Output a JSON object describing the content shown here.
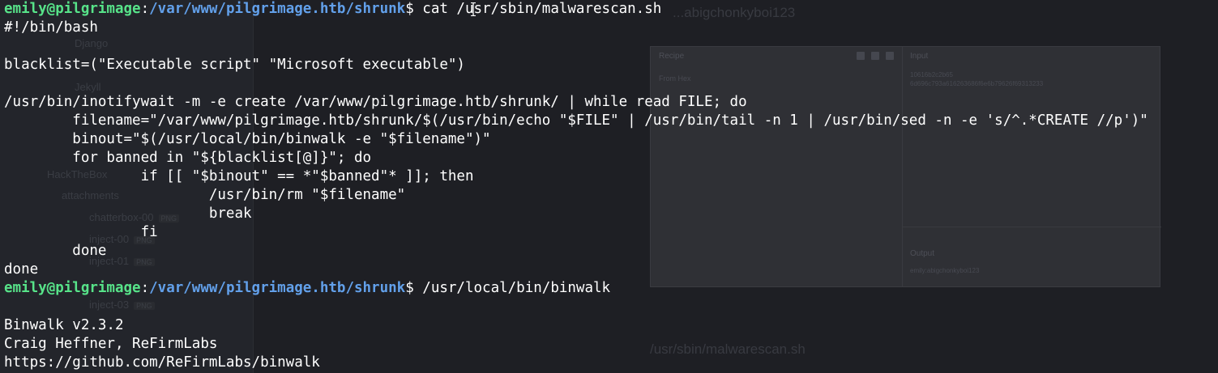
{
  "background": {
    "tree_items": [
      {
        "label": "Django",
        "badge": ""
      },
      {
        "label": "Jekyll",
        "badge": ""
      },
      {
        "label": "HackTheBox",
        "badge": ""
      },
      {
        "label": "attachments",
        "badge": ""
      },
      {
        "label": "chatterbox-00",
        "badge": "PNG"
      },
      {
        "label": "inject-00",
        "badge": "PNG"
      },
      {
        "label": "inject-01",
        "badge": "PNG"
      },
      {
        "label": "inject-03",
        "badge": "PNG"
      }
    ],
    "faint_top_text": "...abigchonkyboi123",
    "faint_bottom_text": "/usr/sbin/malwarescan.sh",
    "panel": {
      "recipe_label": "Recipe",
      "recipe_op": "From Hex",
      "input_label": "Input",
      "input_lines": [
        "10616b2c2b65",
        "6d696c793a616263686f6e6b79626f69313233"
      ],
      "output_label": "Output",
      "output_text": "emily:abigchonkyboi123"
    }
  },
  "terminal": {
    "prompt": {
      "user_host": "emily@pilgrimage",
      "separator": ":",
      "path": "/var/www/pilgrimage.htb/shrunk",
      "symbol": "$ "
    },
    "command_1": "cat /usr/sbin/malwarescan.sh",
    "output_1": [
      "#!/bin/bash",
      "",
      "blacklist=(\"Executable script\" \"Microsoft executable\")",
      "",
      "/usr/bin/inotifywait -m -e create /var/www/pilgrimage.htb/shrunk/ | while read FILE; do",
      "        filename=\"/var/www/pilgrimage.htb/shrunk/$(/usr/bin/echo \"$FILE\" | /usr/bin/tail -n 1 | /usr/bin/sed -n -e 's/^.*CREATE //p')\"",
      "        binout=\"$(/usr/local/bin/binwalk -e \"$filename\")\"",
      "        for banned in \"${blacklist[@]}\"; do",
      "                if [[ \"$binout\" == *\"$banned\"* ]]; then",
      "                        /usr/bin/rm \"$filename\"",
      "                        break",
      "                fi",
      "        done",
      "done"
    ],
    "command_2": "/usr/local/bin/binwalk",
    "output_2": [
      "",
      "Binwalk v2.3.2",
      "Craig Heffner, ReFirmLabs",
      "https://github.com/ReFirmLabs/binwalk"
    ]
  }
}
